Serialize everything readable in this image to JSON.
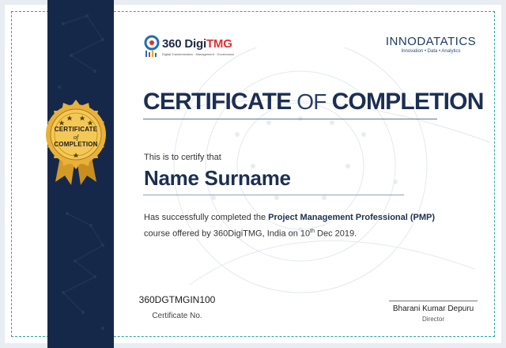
{
  "certificate": {
    "title_part1": "CERTIFICATE",
    "title_part2": " OF ",
    "title_part3": "COMPLETION",
    "certify_line": "This is to certify that",
    "recipient_name": "Name Surname",
    "body_prefix": "Has successfully completed the ",
    "course_name": "Project Management Professional (PMP)",
    "body_line2_prefix": "course offered by 360DigiTMG, India on 10",
    "day_suffix": "th",
    "body_line2_suffix": " Dec 2019.",
    "certificate_number": "360DGTMGIN100",
    "certificate_number_label": "Certificate No.",
    "signatory_name": "Bharani Kumar Depuru",
    "signatory_title": "Director"
  },
  "seal": {
    "line1": "CERTIFICATE",
    "line2": "of",
    "line3": "COMPLETION"
  },
  "logos": {
    "left_brand_prefix": "360 Digi",
    "left_brand_suffix": "TMG",
    "left_tagline": "Digital Transformation · Management · Governance",
    "right_brand": "INNODATATICS",
    "right_tagline": "Innovation • Data • Analytics"
  },
  "colors": {
    "navy": "#16284a",
    "title": "#1c2f52",
    "gold": "#e7b13a",
    "teal_border": "#2aa6a0"
  }
}
